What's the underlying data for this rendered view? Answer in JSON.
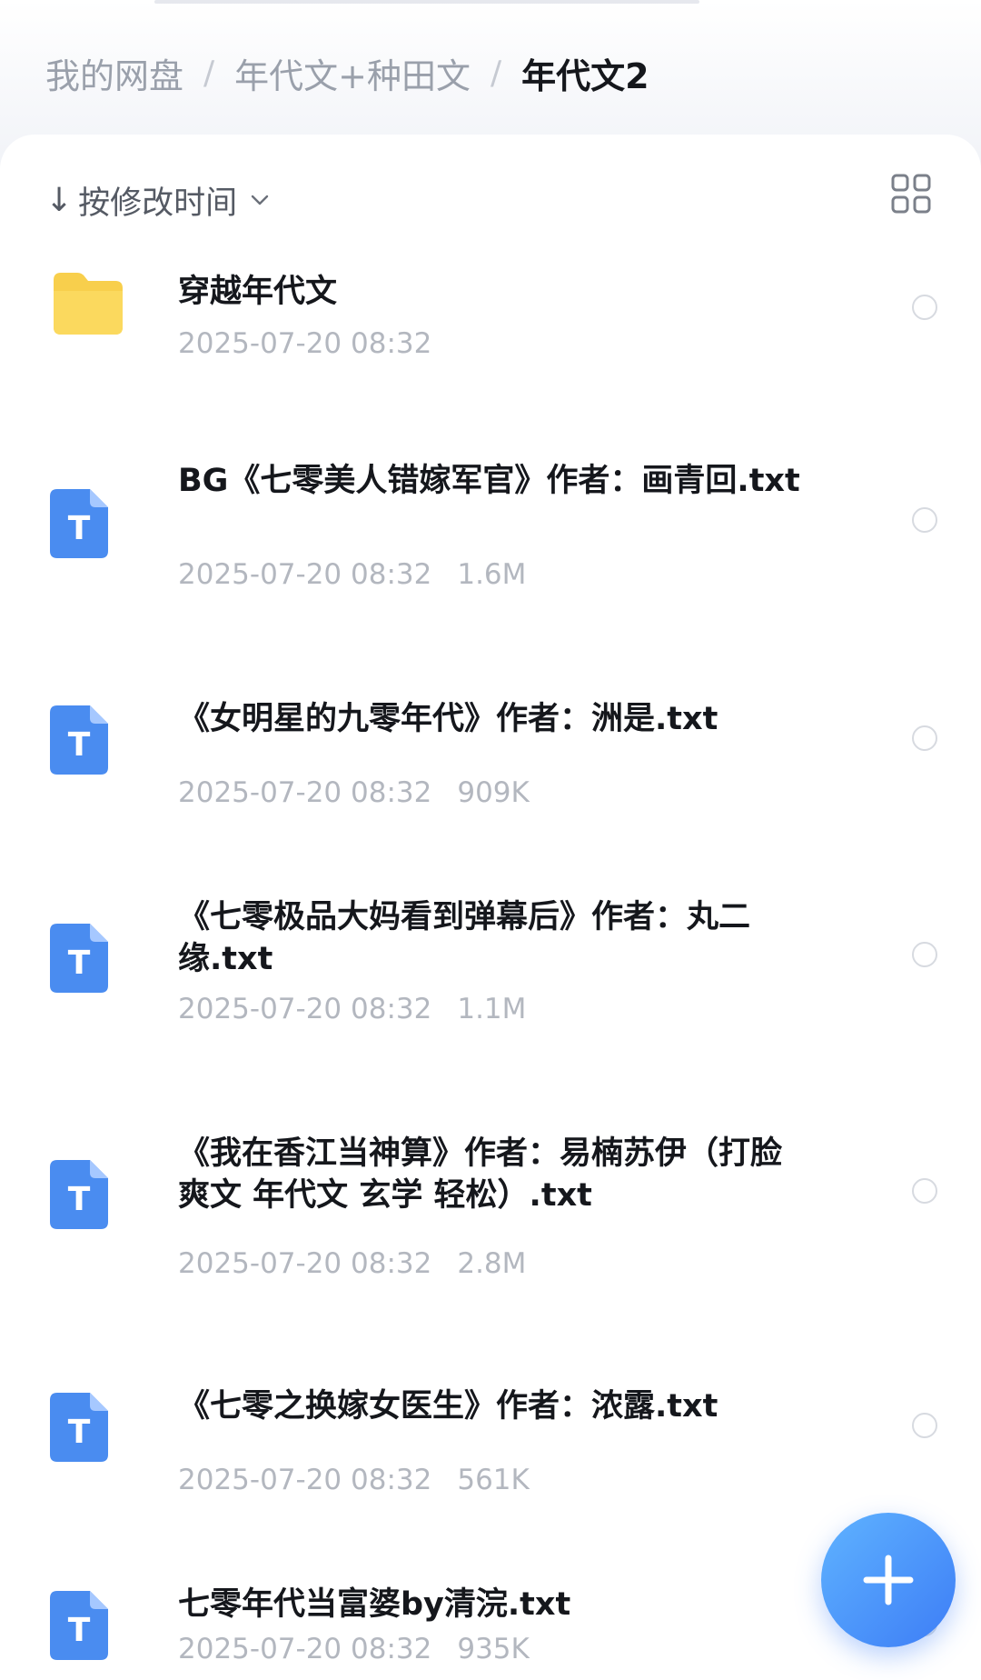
{
  "breadcrumb": {
    "items": [
      "我的网盘",
      "年代文+种田文",
      "年代文2"
    ],
    "separator": "/"
  },
  "sort": {
    "arrow": "↓",
    "label": "按修改时间",
    "icon": "chevron-down-icon"
  },
  "view_toggle": {
    "icon": "grid-view-icon"
  },
  "files": [
    {
      "type": "folder",
      "icon": "folder-icon",
      "name": "穿越年代文",
      "date": "2025-07-20 08:32",
      "size": ""
    },
    {
      "type": "txt",
      "icon": "text-file-icon",
      "icon_letter": "T",
      "name": "BG《七零美人错嫁军官》作者：画青回.txt",
      "date": "2025-07-20 08:32",
      "size": "1.6M"
    },
    {
      "type": "txt",
      "icon": "text-file-icon",
      "icon_letter": "T",
      "name": "《女明星的九零年代》作者：洲是.txt",
      "date": "2025-07-20 08:32",
      "size": "909K"
    },
    {
      "type": "txt",
      "icon": "text-file-icon",
      "icon_letter": "T",
      "name": "《七零极品大妈看到弹幕后》作者：丸二缘.txt",
      "date": "2025-07-20 08:32",
      "size": "1.1M"
    },
    {
      "type": "txt",
      "icon": "text-file-icon",
      "icon_letter": "T",
      "name": "《我在香江当神算》作者：易楠苏伊（打脸 爽文 年代文 玄学 轻松）.txt",
      "date": "2025-07-20 08:32",
      "size": "2.8M"
    },
    {
      "type": "txt",
      "icon": "text-file-icon",
      "icon_letter": "T",
      "name": "《七零之换嫁女医生》作者：浓露.txt",
      "date": "2025-07-20 08:32",
      "size": "561K"
    },
    {
      "type": "txt",
      "icon": "text-file-icon",
      "icon_letter": "T",
      "name": "七零年代当富婆by清浣.txt",
      "date": "2025-07-20 08:32",
      "size": "935K"
    }
  ],
  "fab": {
    "icon": "plus-icon"
  },
  "colors": {
    "folder": "#f8cf4c",
    "text_file": "#4a8cf0",
    "fab": "#3d7df6"
  }
}
